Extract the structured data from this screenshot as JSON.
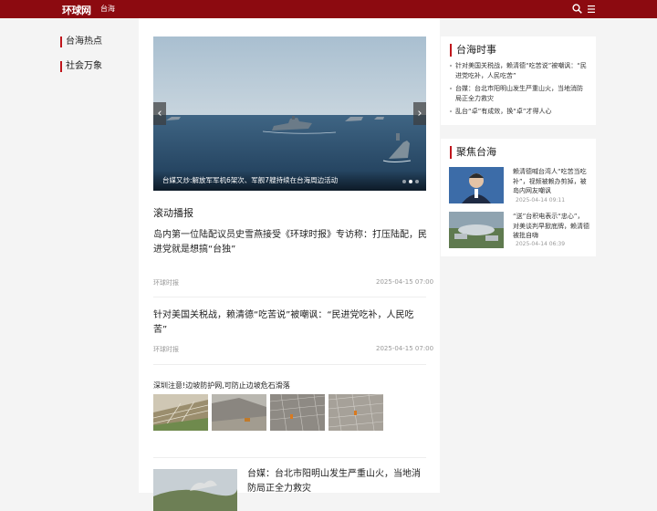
{
  "header": {
    "logo": "环球网",
    "channel": "台海",
    "search_icon": "search-icon",
    "menu_icon": "menu-icon",
    "brand_color": "#8c0a10"
  },
  "left_nav": [
    {
      "label": "台海热点"
    },
    {
      "label": "社会万象"
    }
  ],
  "carousel": {
    "caption": "台媒又炒:解放军军机6架次、军舰7艘持续在台海周边活动",
    "slides": 3,
    "active": 2
  },
  "scroll": {
    "title": "滚动播报",
    "items": [
      {
        "title": "岛内第一位陆配议员史雪燕接受《环球时报》专访称：打压陆配，民进党就是想搞“台独”",
        "source": "环球时报",
        "time": "2025-04-15 07:00"
      },
      {
        "title": "针对美国关税战，赖清德“吃苦说”被嘲讽：“民进党吃补，人民吃苦”",
        "source": "环球时报",
        "time": "2025-04-15 07:00"
      }
    ],
    "gallery": {
      "title": "深圳注意!边坡防护网,可防止边坡危石滑落"
    },
    "bottom": {
      "title": "台媒：台北市阳明山发生严重山火，当地消防局正全力救灾"
    }
  },
  "sidebar": {
    "current": {
      "title": "台海时事",
      "items": [
        "针对美国关税战，赖清德“吃苦说”被嘲讽：“民进党吃补，人民吃苦”",
        "台媒：台北市阳明山发生严重山火，当地消防局正全力救灾",
        "乱台“卓”有成效，换“卓”才得人心"
      ]
    },
    "focus": {
      "title": "聚焦台海",
      "items": [
        {
          "text": "赖清德喊台湾人“吃苦当吃补”，视频被赖办剪掉，被岛内网友嘲讽",
          "time": "2025-04-14 09:11"
        },
        {
          "text": "“送”台积电表示“忠心”，对美谈判早掀底牌，赖清德被批自嗨",
          "time": "2025-04-14 06:39"
        }
      ]
    }
  }
}
